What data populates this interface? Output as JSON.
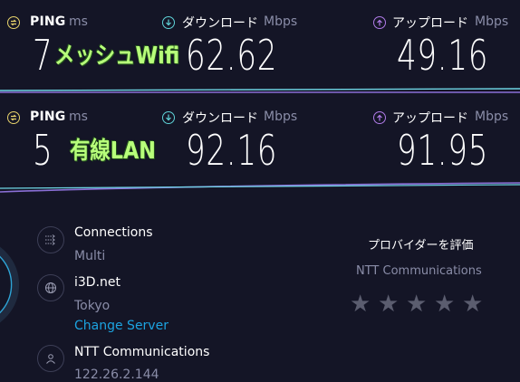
{
  "row1": {
    "ping_label": "PING",
    "ping_unit": "ms",
    "download_label": "ダウンロード",
    "download_unit": "Mbps",
    "upload_label": "アップロード",
    "upload_unit": "Mbps",
    "ping_value": "7",
    "tag": "メッシュWifi",
    "download_value": "62.62",
    "upload_value": "49.16"
  },
  "row2": {
    "ping_label": "PING",
    "ping_unit": "ms",
    "download_label": "ダウンロード",
    "download_unit": "Mbps",
    "upload_label": "アップロード",
    "upload_unit": "Mbps",
    "ping_value": "5",
    "tag": "有線LAN",
    "download_value": "92.16",
    "upload_value": "91.95"
  },
  "connections": {
    "title": "Connections",
    "value": "Multi"
  },
  "server": {
    "name": "i3D.net",
    "location": "Tokyo",
    "change_label": "Change Server"
  },
  "isp": {
    "name": "NTT Communications",
    "ip": "122.26.2.144"
  },
  "rating": {
    "title": "プロバイダーを評価",
    "provider": "NTT Communications",
    "stars": 5
  },
  "colors": {
    "background": "#141526",
    "ping_icon": "#e8d36b",
    "download_icon": "#5fd3d8",
    "upload_icon": "#b07be8",
    "link": "#1ca3e0",
    "tag": "#b7ff7a"
  },
  "icons": {
    "ping": "ping-icon",
    "download": "download-arrow-icon",
    "upload": "upload-arrow-icon",
    "connections": "connections-icon",
    "server": "globe-icon",
    "isp": "person-icon",
    "rating": "star-icon"
  }
}
